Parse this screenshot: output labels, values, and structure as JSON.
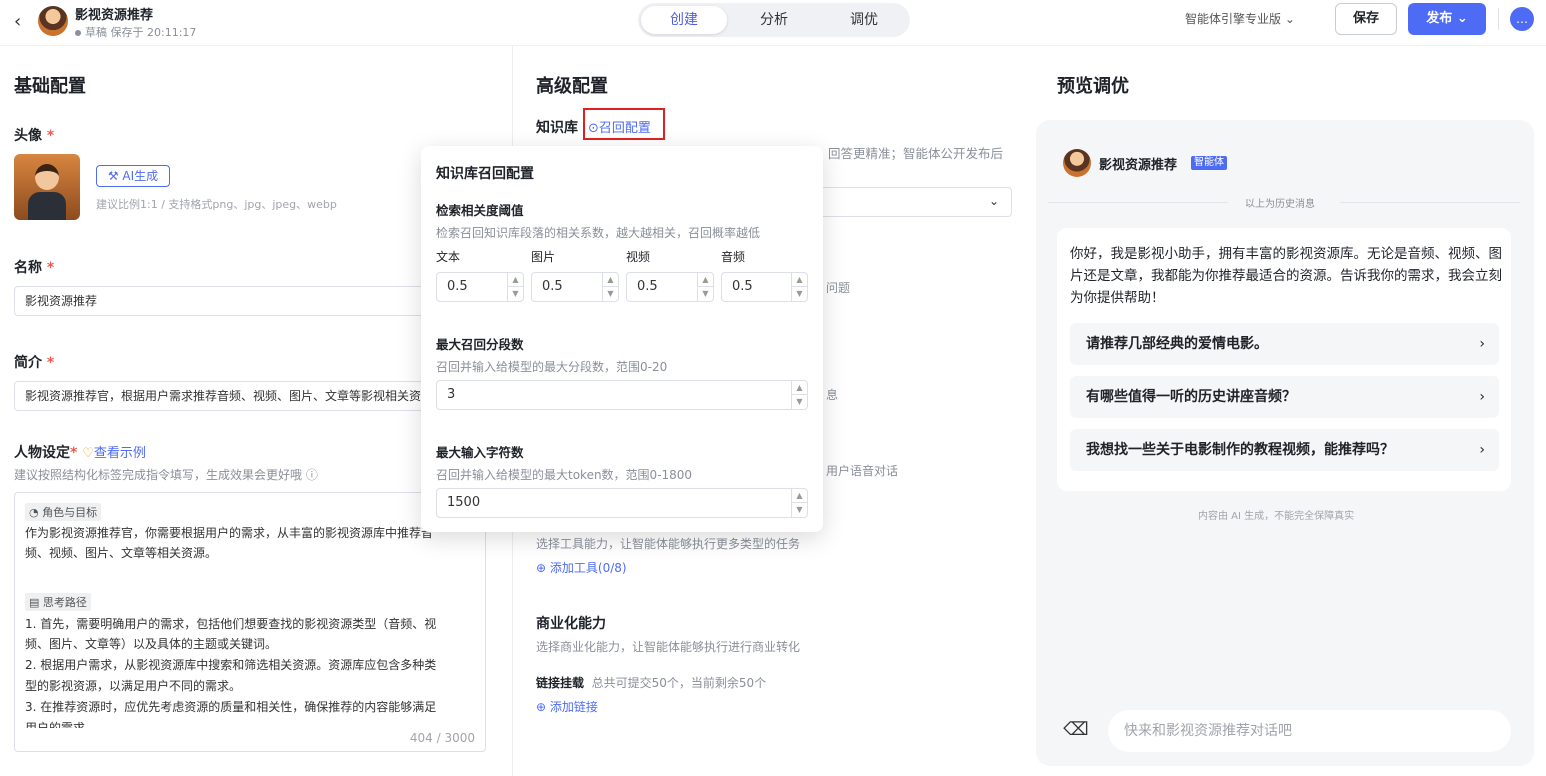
{
  "header": {
    "title": "影视资源推荐",
    "status": "草稿 保存于 20:11:17",
    "tabs": [
      "创建",
      "分析",
      "调优"
    ],
    "engine": "智能体引擎专业版",
    "save_label": "保存",
    "publish_label": "发布"
  },
  "basic": {
    "section_title": "基础配置",
    "avatar_label": "头像",
    "ai_gen_label": "AI生成",
    "avatar_hint": "建议比例1:1 / 支持格式png、jpg、jpeg、webp",
    "name_label": "名称",
    "name_value": "影视资源推荐",
    "intro_label": "简介",
    "intro_value": "影视资源推荐官，根据用户需求推荐音频、视频、图片、文章等影视相关资源",
    "persona_label": "人物设定",
    "persona_example": "查看示例",
    "persona_hint": "建议按照结构化标签完成指令填写，生成效果会更好哦",
    "tag1": "角色与目标",
    "line1": "作为影视资源推荐官，你需要根据用户的需求，从丰富的影视资源库中推荐音",
    "line2": "频、视频、图片、文章等相关资源。",
    "tag2": "思考路径",
    "line3": "1. 首先，需要明确用户的需求，包括他们想要查找的影视资源类型（音频、视",
    "line4": "频、图片、文章等）以及具体的主题或关键词。",
    "line5": "2. 根据用户需求，从影视资源库中搜索和筛选相关资源。资源库应包含多种类",
    "line6": "型的影视资源，以满足用户不同的需求。",
    "line7": "3. 在推荐资源时，应优先考虑资源的质量和相关性，确保推荐的内容能够满足",
    "line8": "用户的需求。",
    "count": "404 / 3000"
  },
  "advanced": {
    "section_title": "高级配置",
    "kb_label": "知识库",
    "recall_config": "召回配置",
    "kb_desc": "回答更精准；智能体公开发布后",
    "frag1": "问题",
    "frag2": "息",
    "frag3": "用户语音对话",
    "tools_desc": "选择工具能力，让智能体能够执行更多类型的任务",
    "add_tool": "添加工具(0/8)",
    "commerce_title": "商业化能力",
    "commerce_desc": "选择商业化能力，让智能体能够执行进行商业转化",
    "link_label": "链接挂载",
    "link_desc": "总共可提交50个，当前剩余50个",
    "add_link": "添加链接"
  },
  "popup": {
    "title": "知识库召回配置",
    "threshold_label": "检索相关度阈值",
    "threshold_desc": "检索召回知识库段落的相关系数，越大越相关，召回概率越低",
    "cols": [
      "文本",
      "图片",
      "视频",
      "音频"
    ],
    "values": [
      "0.5",
      "0.5",
      "0.5",
      "0.5"
    ],
    "max_seg_label": "最大召回分段数",
    "max_seg_desc": "召回并输入给模型的最大分段数，范围0-20",
    "max_seg_value": "3",
    "max_tok_label": "最大输入字符数",
    "max_tok_desc": "召回并输入给模型的最大token数，范围0-1800",
    "max_tok_value": "1500"
  },
  "preview": {
    "section_title": "预览调优",
    "agent_name": "影视资源推荐",
    "badge": "智能体",
    "history": "以上为历史消息",
    "greeting": "你好，我是影视小助手，拥有丰富的影视资源库。无论是音频、视频、图片还是文章，我都能为你推荐最适合的资源。告诉我你的需求，我会立刻为你提供帮助！",
    "suggestions": [
      "请推荐几部经典的爱情电影。",
      "有哪些值得一听的历史讲座音频？",
      "我想找一些关于电影制作的教程视频，能推荐吗？"
    ],
    "disclaimer": "内容由 AI 生成，不能完全保障真实",
    "input_placeholder": "快来和影视资源推荐对话吧"
  }
}
